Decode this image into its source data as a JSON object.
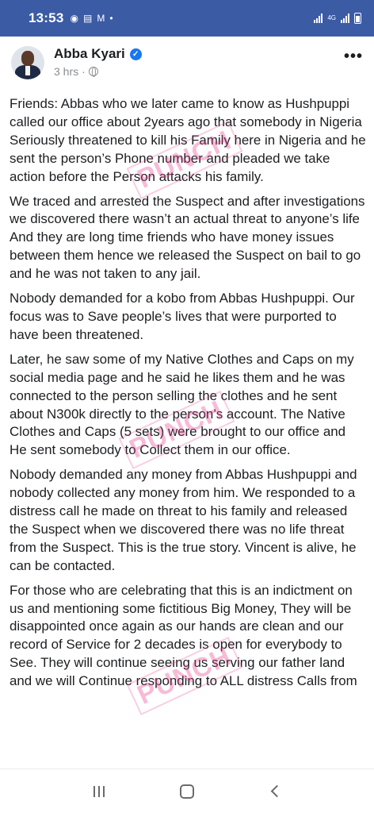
{
  "status_bar": {
    "time": "13:53",
    "network_label": "4G",
    "colors": {
      "background": "#3b5ba5"
    }
  },
  "post": {
    "author": "Abba Kyari",
    "timestamp": "3 hrs",
    "verified": true,
    "paragraphs": [
      "Friends: Abbas who we later came to know as Hushpuppi called our office about 2years ago that somebody in Nigeria Seriously threatened to kill his Family here in Nigeria and he sent the person’s Phone number and pleaded we take action before the Person attacks his family.",
      "We traced and arrested the Suspect and after investigations we discovered there wasn’t an actual threat to anyone’s life And they are long time friends who have money issues between them hence we released the Suspect on bail to go and he was not taken to any jail.",
      "Nobody demanded for a kobo from Abbas Hushpuppi. Our focus was to Save people’s lives that were purported to have been threatened.",
      "Later, he saw some of my Native Clothes and Caps on my social media page and he said he likes them and he was connected to the person selling the clothes and he sent about N300k directly to the person’s account. The Native Clothes and Caps (5 sets) were brought to our office and He sent somebody to Collect them in our office.",
      "Nobody demanded any money from Abbas Hushpuppi and nobody collected any money from him. We responded to a distress call he made on threat to his family and released the Suspect when we discovered there was no life threat from the Suspect. This is the true story. Vincent is alive, he can be contacted.",
      "For those who are celebrating that this is an indictment on us and mentioning some fictitious Big Money, They will be disappointed once again as our hands are clean and our record of Service for 2 decades is open for everybody to See. They will continue seeing us serving our father land and we will Continue responding to ALL distress Calls from"
    ]
  },
  "watermark": {
    "text": "PUNCH",
    "color": "#e93c8c"
  },
  "nav_bar": {
    "icons": [
      "recent-apps-icon",
      "home-icon",
      "back-icon"
    ]
  }
}
